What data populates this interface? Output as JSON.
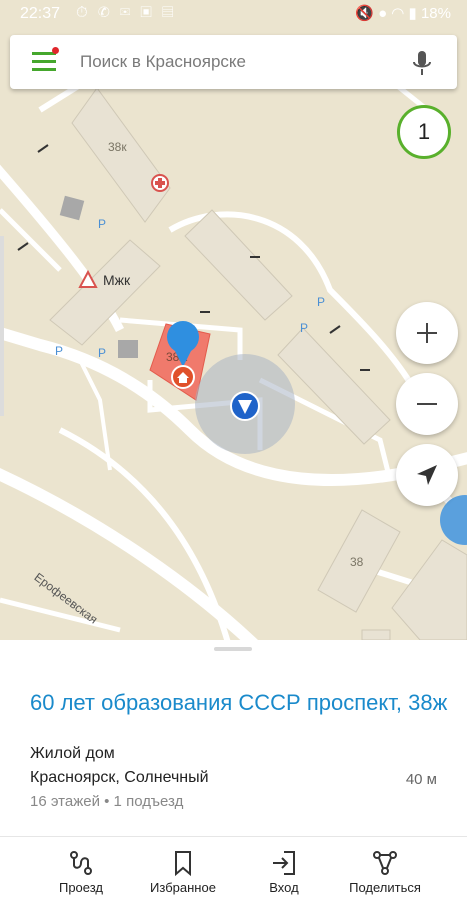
{
  "status_bar": {
    "time": "22:37",
    "battery": "18%"
  },
  "search": {
    "placeholder": "Поиск в Красноярске"
  },
  "badge": {
    "count": "1"
  },
  "map_labels": {
    "building_38k": "38к",
    "building_38zh": "38ж",
    "building_38": "38",
    "mzhk": "Мжк",
    "street": "Ерофеевская",
    "parking": "P"
  },
  "place": {
    "address": "60 лет образования СССР проспект, 38ж",
    "type": "Жилой дом",
    "city": "Красноярск, Солнечный",
    "distance": "40 м",
    "details": "16 этажей • 1 подъезд"
  },
  "nav": {
    "route": "Проезд",
    "favorites": "Избранное",
    "entrance": "Вход",
    "share": "Поделиться"
  },
  "colors": {
    "accent_green": "#45a72d",
    "link_blue": "#1a8acb",
    "pin_blue": "#2f8fe0",
    "selected_building": "#f07a6c"
  }
}
